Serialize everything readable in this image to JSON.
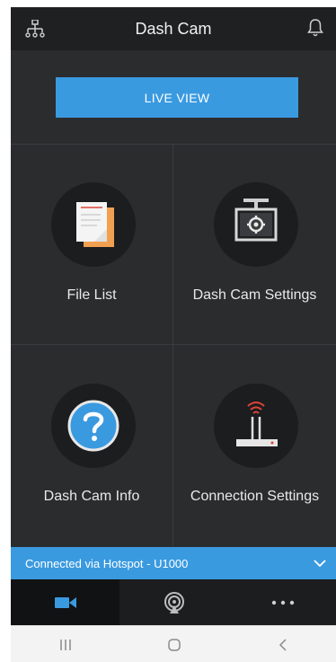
{
  "header": {
    "title": "Dash Cam",
    "left_icon": "network-tree-icon",
    "right_icon": "bell-icon"
  },
  "live_view": {
    "label": "LIVE VIEW"
  },
  "menu": [
    {
      "label": "File List",
      "icon": "file-list-icon"
    },
    {
      "label": "Dash Cam Settings",
      "icon": "dash-cam-settings-icon"
    },
    {
      "label": "Dash Cam Info",
      "icon": "question-icon"
    },
    {
      "label": "Connection Settings",
      "icon": "wifi-router-icon"
    }
  ],
  "connection": {
    "text": "Connected via Hotspot -  U1000",
    "icon": "chevron-down-icon"
  },
  "tabs": [
    {
      "name": "camera",
      "icon": "video-camera-icon",
      "active": true
    },
    {
      "name": "broadcast",
      "icon": "broadcast-icon",
      "active": false
    },
    {
      "name": "more",
      "icon": "more-icon",
      "active": false
    }
  ],
  "colors": {
    "accent": "#3a9ae0",
    "background": "#2b2c2e",
    "header_bg": "#1f2022",
    "icon_orange": "#f0a050",
    "router_red": "#e0443a"
  }
}
